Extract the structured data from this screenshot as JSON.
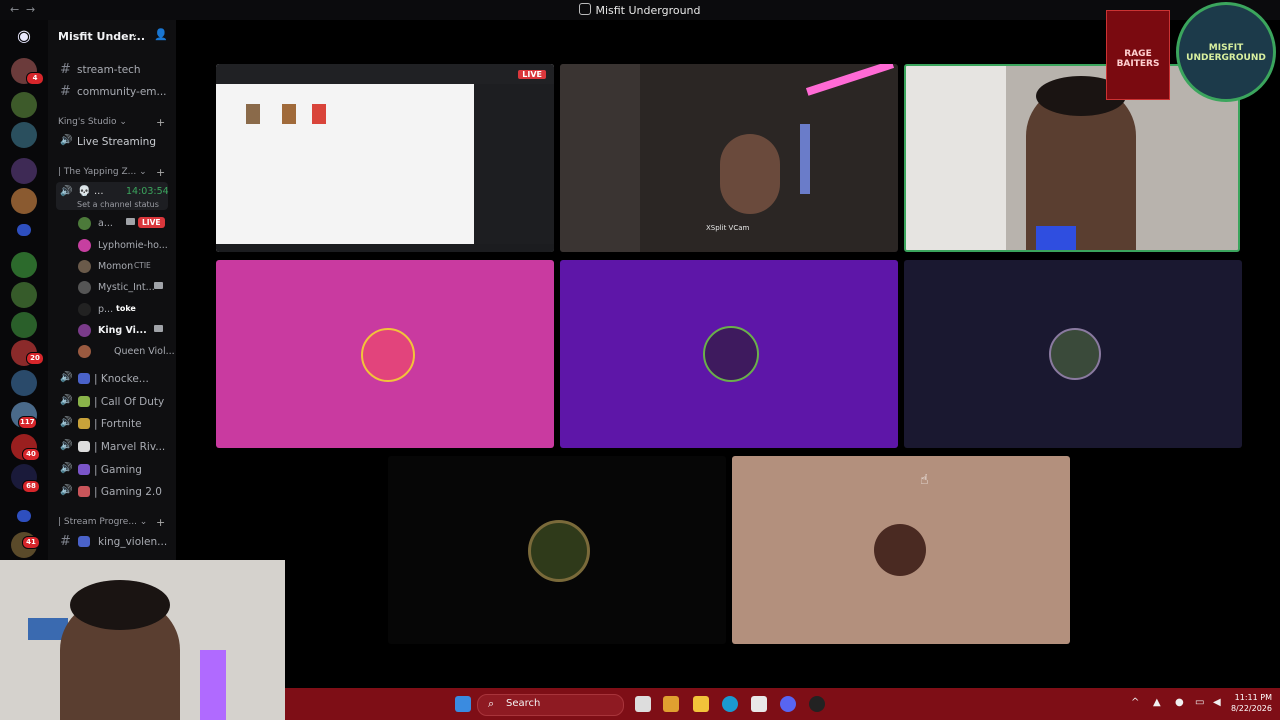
{
  "window": {
    "title": "Misfit Underground",
    "back": "←",
    "forward": "→"
  },
  "server": {
    "name": "Misfit Under...",
    "chevron": "⌄"
  },
  "rail_badges": [
    "4",
    "20",
    "117",
    "40",
    "68",
    "41"
  ],
  "channels_top": [
    {
      "name": "stream-tech"
    },
    {
      "name": "community-em..."
    }
  ],
  "categories": {
    "kings_studio": "King's Studio ⌄",
    "yapping": "| The Yapping Z... ⌄",
    "stream_progress": "| Stream Progre... ⌄"
  },
  "live_streaming": "Live Streaming",
  "current_user": {
    "name": "...",
    "timer": "14:03:54",
    "status_prompt": "Set a channel status"
  },
  "voice_users": [
    {
      "name": "a...",
      "live": "LIVE",
      "avatar_color": "#4c7a3a"
    },
    {
      "name": "Lyphomie-ho...",
      "avatar_color": "#c63fa0"
    },
    {
      "name": "Momon",
      "tag": "CTIE",
      "avatar_color": "#6a5a4a"
    },
    {
      "name": "Mystic_Int...",
      "avatar_color": "#555"
    },
    {
      "name": "p...",
      "tag": "toke",
      "avatar_color": "#222"
    },
    {
      "name": "King Vi...",
      "avatar_color": "#7a3b8a"
    },
    {
      "name": "Queen Viol...",
      "avatar_color": "#9a5a40"
    }
  ],
  "voice_channels": [
    {
      "name": "| Knocke...",
      "emoji_color": "#4a62c9"
    },
    {
      "name": "| Call Of Duty",
      "emoji_color": "#8ab34a"
    },
    {
      "name": "| Fortnite",
      "emoji_color": "#c8a23a"
    },
    {
      "name": "| Marvel Riv...",
      "emoji_color": "#dddddd"
    },
    {
      "name": "| Gaming",
      "emoji_color": "#7a55c9"
    },
    {
      "name": "| Gaming 2.0",
      "emoji_color": "#c9555a"
    }
  ],
  "text_channel_bottom": {
    "name": "king_violen..."
  },
  "tiles": {
    "screenshare_live": "LIVE",
    "xsplit_label": "XSplit VCam",
    "colors": {
      "pink": "#c93aa0",
      "purple": "#5e16a8",
      "navy": "#1a1830",
      "dark": "#060606",
      "tan": "#b3907d",
      "active_border": "#3ba55d"
    }
  },
  "taskbar": {
    "search": "Search",
    "time": "11:11 PM",
    "date": "8/22/2026",
    "accent": "#7e0e16"
  },
  "overlay": {
    "logo_text": "MISFIT UNDERGROUND",
    "book_text": "RAGE BAITERS"
  }
}
